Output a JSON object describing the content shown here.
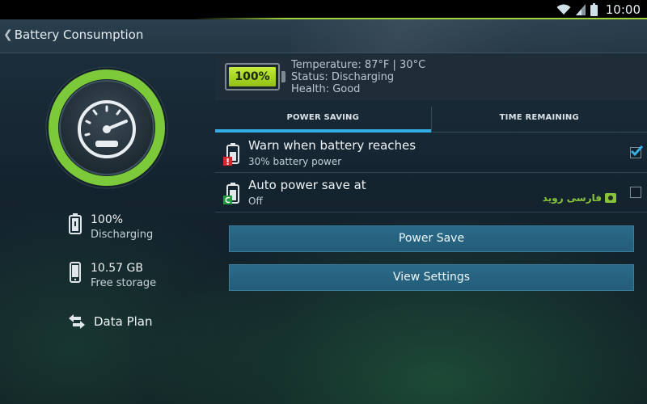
{
  "status_bar": {
    "time": "10:00",
    "icons": [
      "wifi-icon",
      "signal-icon",
      "battery-icon"
    ],
    "accent": "#9fd13c"
  },
  "action_bar": {
    "back_glyph": "❮",
    "title": "Battery Consumption"
  },
  "sidebar": {
    "gauge_icon": "speedometer-icon",
    "gauge_color": "#7cc93a",
    "battery": {
      "icon": "battery-icon",
      "value": "100%",
      "label": "Discharging"
    },
    "storage": {
      "icon": "phone-icon",
      "value": "10.57 GB",
      "label": "Free storage"
    },
    "data_plan": {
      "icon": "swap-arrows-icon",
      "label": "Data Plan"
    }
  },
  "battery": {
    "level_text": "100%",
    "level_fraction": 1.0,
    "temperature": "Temperature: 87°F | 30°C",
    "status": "Status: Discharging",
    "health": "Health: Good"
  },
  "tabs": [
    {
      "label": "POWER SAVING",
      "active": true
    },
    {
      "label": "TIME REMAINING",
      "active": false
    }
  ],
  "settings": [
    {
      "title": "Warn when battery reaches",
      "subtitle": "30% battery power",
      "checked": true,
      "icon": "battery-warning-icon"
    },
    {
      "title": "Auto power save at",
      "subtitle": "Off",
      "checked": false,
      "icon": "battery-auto-icon"
    }
  ],
  "watermark": {
    "text": "فارسی روید",
    "icon": "lock-icon"
  },
  "buttons": {
    "power_save": "Power Save",
    "view_settings": "View Settings"
  },
  "colors": {
    "tab_active": "#34aee6",
    "button": "#2b6b8a",
    "battery_green": "#a6d421",
    "check_blue": "#35aee6"
  }
}
